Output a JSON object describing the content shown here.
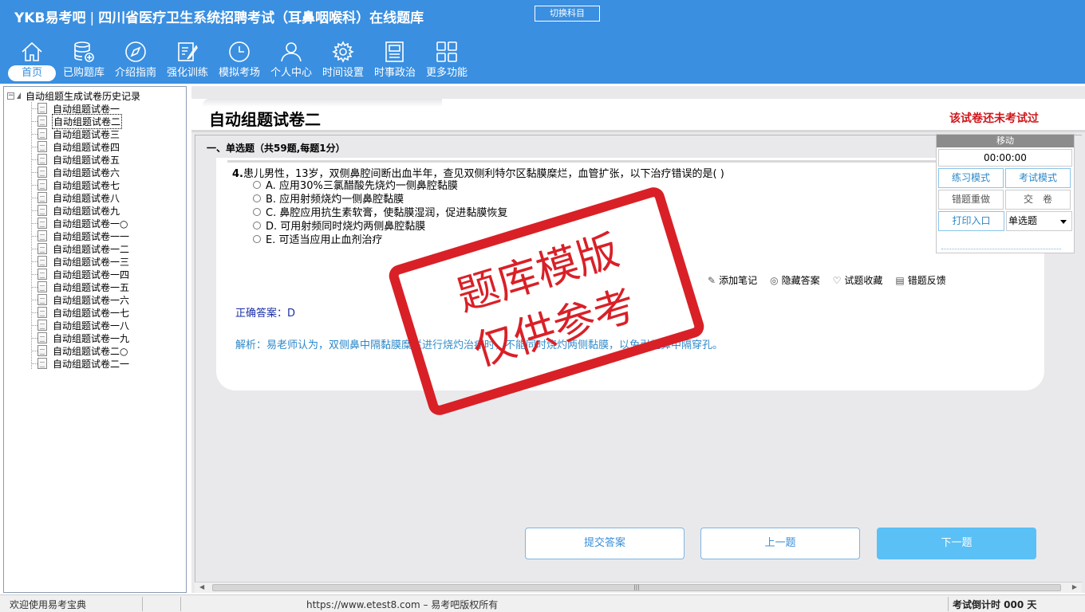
{
  "header": {
    "logo": "YKB易考吧",
    "title": "四川省医疗卫生系统招聘考试（耳鼻咽喉科）在线题库",
    "switch_label": "切换科目",
    "nav": [
      {
        "label": "首页",
        "icon": "home-icon"
      },
      {
        "label": "已购题库",
        "icon": "database-icon"
      },
      {
        "label": "介绍指南",
        "icon": "compass-icon"
      },
      {
        "label": "强化训练",
        "icon": "edit-icon"
      },
      {
        "label": "模拟考场",
        "icon": "clock-icon"
      },
      {
        "label": "个人中心",
        "icon": "user-icon"
      },
      {
        "label": "时间设置",
        "icon": "gear-icon"
      },
      {
        "label": "时事政治",
        "icon": "news-icon"
      },
      {
        "label": "更多功能",
        "icon": "grid-icon"
      }
    ]
  },
  "tree": {
    "root": "自动组题生成试卷历史记录",
    "items": [
      "自动组题试卷一",
      "自动组题试卷二",
      "自动组题试卷三",
      "自动组题试卷四",
      "自动组题试卷五",
      "自动组题试卷六",
      "自动组题试卷七",
      "自动组题试卷八",
      "自动组题试卷九",
      "自动组题试卷一○",
      "自动组题试卷一一",
      "自动组题试卷一二",
      "自动组题试卷一三",
      "自动组题试卷一四",
      "自动组题试卷一五",
      "自动组题试卷一六",
      "自动组题试卷一七",
      "自动组题试卷一八",
      "自动组题试卷一九",
      "自动组题试卷二○",
      "自动组题试卷二一"
    ],
    "selected_index": 1
  },
  "main": {
    "page_title": "自动组题试卷二",
    "status": "该试卷还未考试过",
    "section_title": "一、单选题（共59题,每题1分）",
    "question": {
      "number": "4.",
      "text": "患儿男性，13岁，双侧鼻腔间断出血半年，查见双侧利特尔区黏膜糜烂，血管扩张，以下治疗错误的是( )",
      "options": [
        "A. 应用30%三氯醋酸先烧灼一侧鼻腔黏膜",
        "B. 应用射频烧灼一侧鼻腔黏膜",
        "C. 鼻腔应用抗生素软膏，使黏膜湿润，促进黏膜恢复",
        "D. 可用射频同时烧灼两侧鼻腔黏膜",
        "E. 可适当应用止血剂治疗"
      ]
    },
    "actions": {
      "add_note": "添加笔记",
      "hide_answer": "隐藏答案",
      "favorite": "试题收藏",
      "feedback": "错题反馈"
    },
    "answer": "正确答案：D",
    "analysis": "解析：易老师认为，双侧鼻中隔黏膜糜烂进行烧灼治疗时，不能同时烧灼两侧黏膜，以免引起鼻中隔穿孔。",
    "buttons": {
      "submit": "提交答案",
      "prev": "上一题",
      "next": "下一题"
    }
  },
  "side_panel": {
    "move": "移动",
    "timer": "00:00:00",
    "practice_mode": "练习模式",
    "exam_mode": "考试模式",
    "redo_wrong": "错题重做",
    "hand_in": "交　卷",
    "print": "打印入口",
    "question_type": "单选题"
  },
  "stamp": {
    "line1": "题库模版",
    "line2": "仅供参考"
  },
  "statusbar": {
    "welcome": "欢迎使用易考宝典",
    "copyright": "https://www.etest8.com – 易考吧版权所有",
    "countdown": "考试倒计时 000 天"
  },
  "colors": {
    "header_bg": "#3a8fe0",
    "status_red": "#d0161b",
    "stamp_red": "#d92027",
    "answer_blue": "#1a2fa6",
    "analysis_blue": "#2d88c9",
    "next_btn": "#5bc0f5"
  }
}
